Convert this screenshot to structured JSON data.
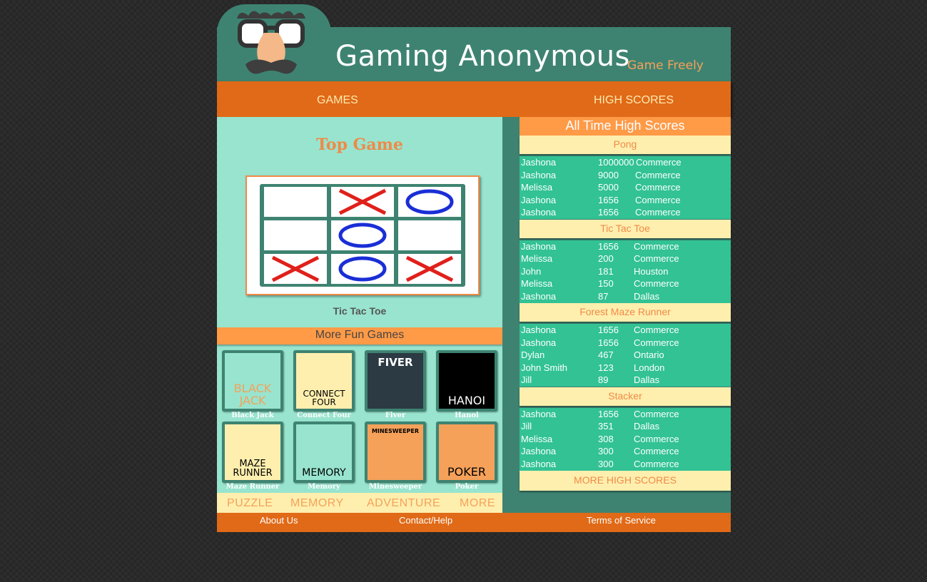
{
  "header": {
    "title": "Gaming Anonymous",
    "tagline": "Game Freely",
    "logo_icon": "groucho-glasses-icon"
  },
  "nav": {
    "games": "GAMES",
    "high_scores": "HIGH SCORES"
  },
  "top_game": {
    "heading": "Top Game",
    "name": "Tic Tac Toe",
    "board": [
      "",
      "X",
      "O",
      "",
      "O",
      "",
      "X",
      "O",
      "X"
    ]
  },
  "more_fun_games": {
    "heading": "More Fun Games",
    "tiles": [
      {
        "label": "Black Jack",
        "art": [
          "BLACK",
          "JACK"
        ]
      },
      {
        "label": "Connect Four",
        "art": [
          "CONNECT",
          "FOUR"
        ]
      },
      {
        "label": "Fiver",
        "art": [
          "FIVER"
        ]
      },
      {
        "label": "Hanoi",
        "art": [
          "HANOI"
        ]
      },
      {
        "label": "Maze Runner",
        "art": [
          "MAZE",
          "RUNNER"
        ]
      },
      {
        "label": "Memory",
        "art": [
          "MEMORY"
        ]
      },
      {
        "label": "Minesweeper",
        "art": [
          "MINESWEEPER"
        ]
      },
      {
        "label": "Poker",
        "art": [
          "POKER"
        ]
      }
    ]
  },
  "categories": [
    "PUZZLE",
    "MEMORY",
    "ADVENTURE",
    "MORE"
  ],
  "high_scores": {
    "heading": "All Time High Scores",
    "games": [
      {
        "name": "Pong",
        "rows": [
          [
            "Jashona",
            "1000000",
            "Commerce"
          ],
          [
            "Jashona",
            "9000",
            "Commerce"
          ],
          [
            "Melissa",
            "5000",
            "Commerce"
          ],
          [
            "Jashona",
            "1656",
            "Commerce"
          ],
          [
            "Jashona",
            "1656",
            "Commerce"
          ]
        ]
      },
      {
        "name": "Tic Tac Toe",
        "rows": [
          [
            "Jashona",
            "1656",
            "Commerce"
          ],
          [
            "Melissa",
            "200",
            "Commerce"
          ],
          [
            "John",
            "181",
            "Houston"
          ],
          [
            "Melissa",
            "150",
            "Commerce"
          ],
          [
            "Jashona",
            "87",
            "Dallas"
          ]
        ]
      },
      {
        "name": "Forest Maze Runner",
        "rows": [
          [
            "Jashona",
            "1656",
            "Commerce"
          ],
          [
            "Jashona",
            "1656",
            "Commerce"
          ],
          [
            "Dylan",
            "467",
            "Ontario"
          ],
          [
            "John Smith",
            "123",
            "London"
          ],
          [
            "Jill",
            "89",
            "Dallas"
          ]
        ]
      },
      {
        "name": "Stacker",
        "rows": [
          [
            "Jashona",
            "1656",
            "Commerce"
          ],
          [
            "Jill",
            "351",
            "Dallas"
          ],
          [
            "Melissa",
            "308",
            "Commerce"
          ],
          [
            "Jashona",
            "300",
            "Commerce"
          ],
          [
            "Jashona",
            "300",
            "Commerce"
          ]
        ]
      }
    ],
    "more_link": "MORE HIGH SCORES"
  },
  "footer": {
    "about": "About Us",
    "contact": "Contact/Help",
    "terms": "Terms of Service"
  },
  "colors": {
    "teal_dark": "#3e8371",
    "orange": "#e06a17",
    "mint": "#98e4ce",
    "green": "#32c294",
    "cream": "#ffefae",
    "x_red": "#e0201b",
    "o_blue": "#1a2ed6"
  }
}
